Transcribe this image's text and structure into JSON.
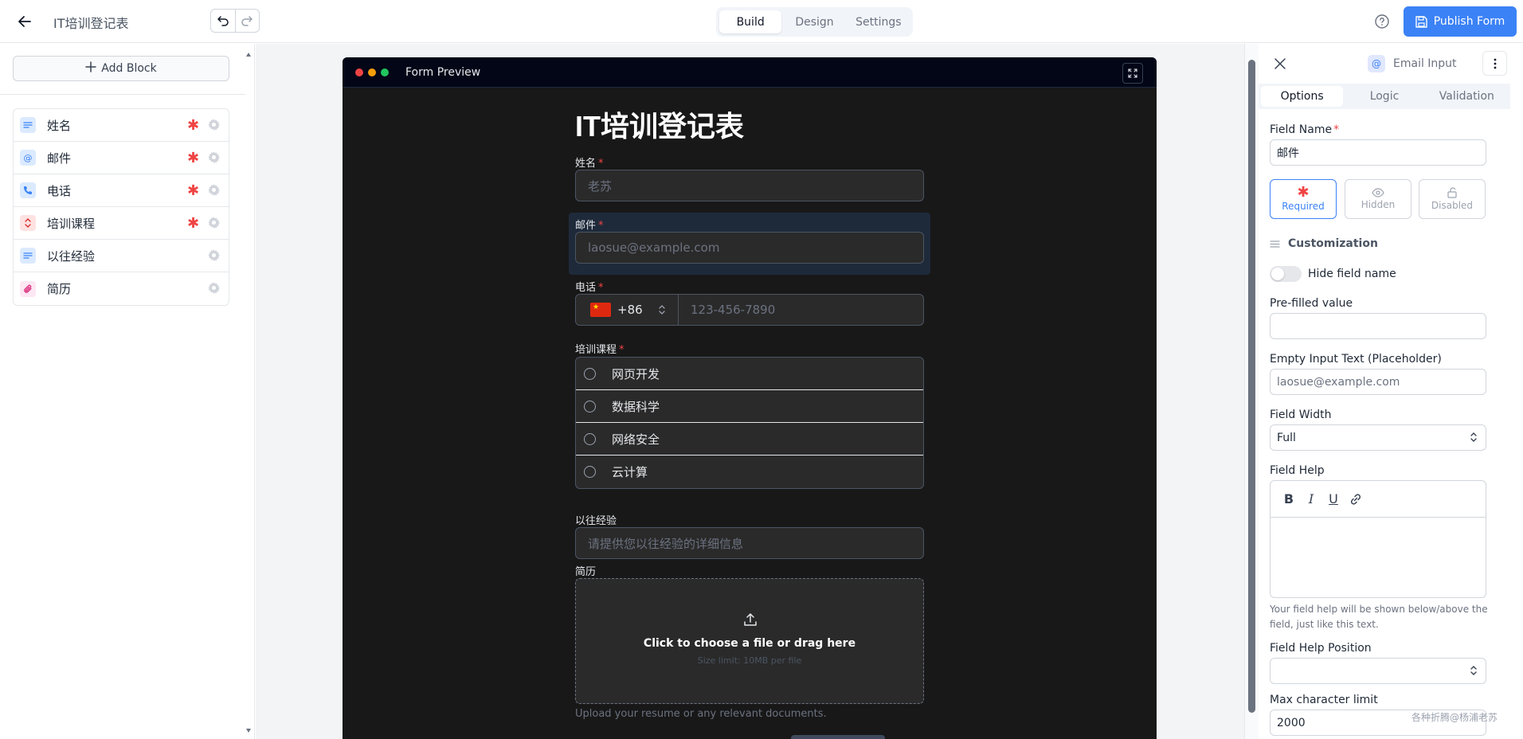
{
  "header": {
    "form_title": "IT培训登记表",
    "tabs": [
      "Build",
      "Design",
      "Settings"
    ],
    "active_tab": "Build",
    "publish_label": "Publish Form"
  },
  "sidebar": {
    "add_block_label": "Add Block",
    "blocks": [
      {
        "label": "姓名",
        "icon": "text-lines-icon",
        "required": true
      },
      {
        "label": "邮件",
        "icon": "at-sign-icon",
        "required": true
      },
      {
        "label": "电话",
        "icon": "phone-icon",
        "required": true
      },
      {
        "label": "培训课程",
        "icon": "select-chevrons-icon",
        "required": true
      },
      {
        "label": "以往经验",
        "icon": "text-lines-icon",
        "required": false
      },
      {
        "label": "简历",
        "icon": "paperclip-icon",
        "required": false
      }
    ]
  },
  "preview": {
    "window_title": "Form Preview",
    "title": "IT培训登记表",
    "required_marker": "*",
    "fields": {
      "name": {
        "label": "姓名",
        "placeholder": "老苏"
      },
      "email": {
        "label": "邮件",
        "placeholder": "laosue@example.com"
      },
      "phone": {
        "label": "电话",
        "country_code": "+86",
        "flag": "🇨🇳",
        "placeholder": "123-456-7890"
      },
      "course": {
        "label": "培训课程",
        "options": [
          "网页开发",
          "数据科学",
          "网络安全",
          "云计算"
        ]
      },
      "experience": {
        "label": "以往经验",
        "placeholder": "请提供您以往经验的详细信息"
      },
      "resume": {
        "label": "简历",
        "upload_title": "Click to choose a file or drag here",
        "upload_sub": "Size limit: 10MB per file",
        "help": "Upload your resume or any relevant documents."
      }
    }
  },
  "settings_panel": {
    "field_type": "Email Input",
    "tabs": [
      "Options",
      "Logic",
      "Validation"
    ],
    "active_tab": "Options",
    "field_name_label": "Field Name",
    "field_name_value": "邮件",
    "toggles": {
      "required": "Required",
      "hidden": "Hidden",
      "disabled": "Disabled"
    },
    "customization_label": "Customization",
    "hide_field_name_label": "Hide field name",
    "prefilled_label": "Pre-filled value",
    "prefilled_value": "",
    "placeholder_label": "Empty Input Text (Placeholder)",
    "placeholder_value": "laosue@example.com",
    "width_label": "Field Width",
    "width_value": "Full",
    "help_label": "Field Help",
    "help_note": "Your field help will be shown below/above the field, just like this text.",
    "help_position_label": "Field Help Position",
    "help_position_value": "",
    "max_char_label": "Max character limit",
    "max_char_value": "2000"
  },
  "watermark": "各种折腾@杨浦老苏",
  "colors": {
    "accent": "#3b82f6",
    "required": "#ef4444",
    "preview_bg": "#181818"
  }
}
